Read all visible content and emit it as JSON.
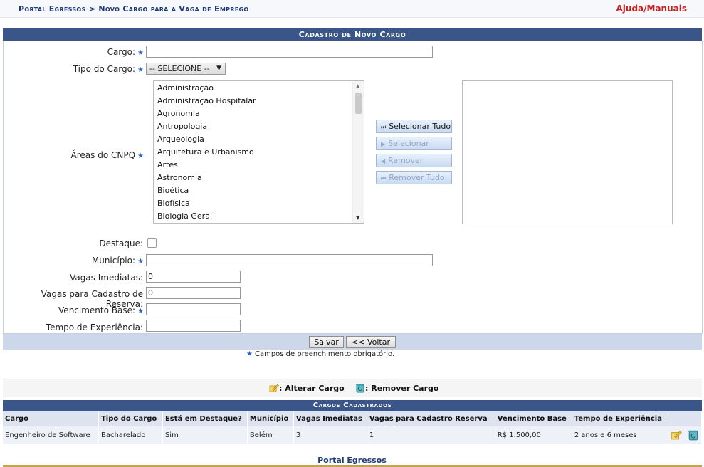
{
  "header": {
    "breadcrumb_root": "Portal Egressos",
    "breadcrumb_sep": ">",
    "breadcrumb_current": "Novo Cargo para a Vaga de Emprego",
    "help_link": "Ajuda/Manuais"
  },
  "form": {
    "title": "Cadastro de Novo Cargo",
    "required_mark": "★",
    "labels": {
      "cargo": "Cargo:",
      "tipo": "Tipo do Cargo:",
      "areas": "Áreas do CNPQ",
      "destaque": "Destaque:",
      "municipio": "Município:",
      "vagas_imediatas": "Vagas Imediatas:",
      "vagas_reserva": "Vagas para Cadastro de Reserva:",
      "vencimento": "Vencimento Base:",
      "tempo": "Tempo de Experiência:"
    },
    "values": {
      "cargo": "",
      "tipo_selected": "-- SELECIONE --",
      "municipio": "",
      "vagas_imediatas": "0",
      "vagas_reserva": "0",
      "vencimento": "",
      "tempo": ""
    },
    "areas_options": [
      "Administração",
      "Administração Hospitalar",
      "Agronomia",
      "Antropologia",
      "Arqueologia",
      "Arquitetura e Urbanismo",
      "Artes",
      "Astronomia",
      "Bioética",
      "Biofísica",
      "Biologia Geral"
    ],
    "move_buttons": {
      "select_all": "Selecionar Tudo",
      "select": "Selecionar",
      "remove": "Remover",
      "remove_all": "Remover Tudo"
    },
    "save_button": "Salvar",
    "back_button": "<< Voltar",
    "required_note": "Campos de preenchimento obrigatório."
  },
  "legend": {
    "edit_label": ": Alterar Cargo",
    "remove_label": ": Remover Cargo"
  },
  "table": {
    "title": "Cargos Cadastrados",
    "headers": [
      "Cargo",
      "Tipo do Cargo",
      "Está em Destaque?",
      "Município",
      "Vagas Imediatas",
      "Vagas para Cadastro Reserva",
      "Vencimento Base",
      "Tempo de Experiência",
      ""
    ],
    "rows": [
      [
        "Engenheiro de Software",
        "Bacharelado",
        "Sim",
        "Belém",
        "3",
        "1",
        "R$ 1.500,00",
        "2 anos e 6 meses"
      ]
    ]
  },
  "footer": {
    "text": "Portal Egressos"
  },
  "colors": {
    "title_bar": "#3a5587",
    "help_link": "#c81e1e",
    "required_star": "#2a62c9",
    "footer_line": "#c4a34f"
  }
}
